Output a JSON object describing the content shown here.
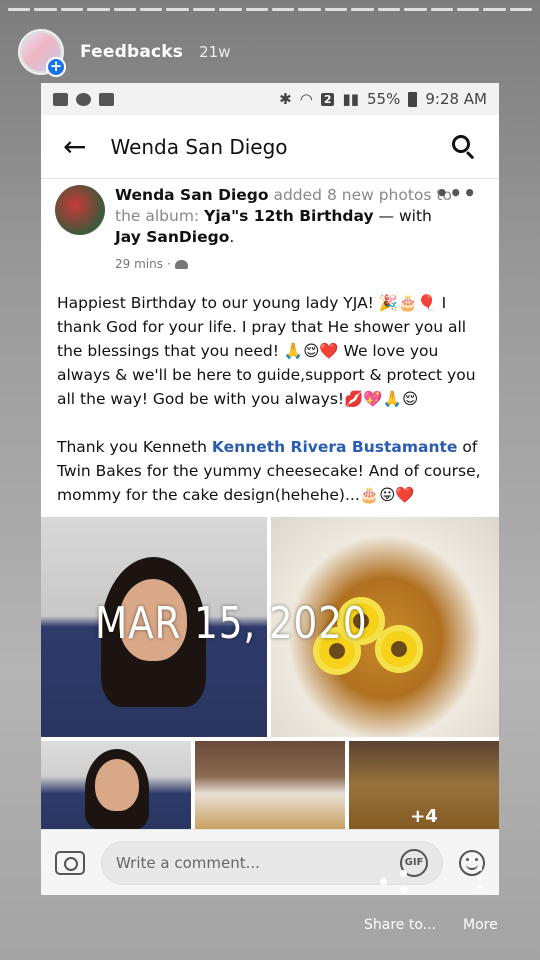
{
  "story": {
    "title": "Feedbacks",
    "time": "21w",
    "share_label": "Share to...",
    "more_label": "More"
  },
  "status_bar": {
    "sim_badge": "2",
    "battery": "55%",
    "time": "9:28 AM"
  },
  "fb_header": {
    "title": "Wenda San Diego"
  },
  "post": {
    "author": "Wenda San Diego",
    "action": " added 8 new photos to the album: ",
    "album": "Yja\"s 12th Birthday",
    "with_text": " — with ",
    "tagged": "Jay SanDiego",
    "period": ".",
    "time": "29 mins",
    "dot": "·",
    "text_p1": "Happiest Birthday to our young lady YJA! 🎉🎂🎈 I thank God for your life. I pray that He shower you all the blessings that you need! 🙏😌❤️ We love you always & we'll be here to guide,support & protect you all the way! God be with you always!💋💖🙏😌",
    "text_p2_a": "Thank you Kenneth ",
    "text_p2_link": "Kenneth Rivera Bustamante",
    "text_p2_b": " of Twin Bakes for the yummy cheesecake! And of course, mommy for the cake design(hehehe)...🎂😛❤️",
    "photo_more": "+4",
    "date_stamp": "MAR 15, 2020"
  },
  "comment": {
    "placeholder": "Write a comment...",
    "gif_label": "GIF"
  },
  "colors": {
    "link": "#2a5db0",
    "story_plus": "#1a73e8"
  }
}
